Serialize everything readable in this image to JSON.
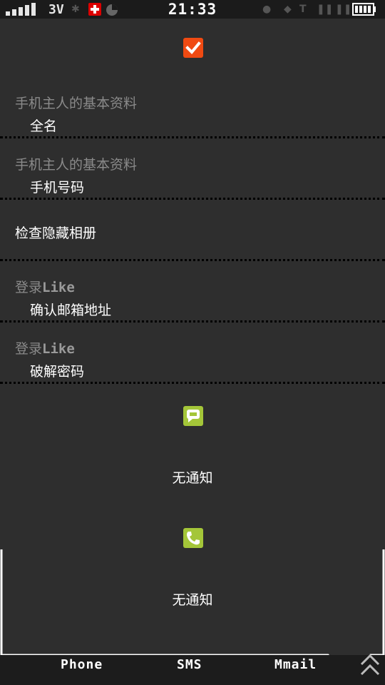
{
  "status_bar": {
    "network": "3V",
    "time": "21:33",
    "icons": [
      "signal-icon",
      "usb-icon",
      "medical-cross-icon",
      "pie-icon",
      "bluetooth-icon",
      "nfc-icon",
      "text-icon",
      "pause-icon",
      "battery-icon"
    ]
  },
  "header": {
    "icon": "checkbox-checked-icon",
    "accent": "#f04a12"
  },
  "rows": [
    {
      "title": "手机主人的基本资料",
      "subtitle": "全名"
    },
    {
      "title": "手机主人的基本资料",
      "subtitle": "手机号码"
    },
    {
      "label": "检查隐藏相册"
    },
    {
      "title_prefix": "登录",
      "title_brand": "Like",
      "subtitle": "确认邮箱地址"
    },
    {
      "title_prefix": "登录",
      "title_brand": "Like",
      "subtitle": "破解密码"
    }
  ],
  "notifications": [
    {
      "icon": "message-bubble-icon",
      "text": "无通知",
      "color": "#a4c639"
    },
    {
      "icon": "phone-icon",
      "text": "无通知",
      "color": "#a4c639"
    }
  ],
  "tabs": [
    {
      "label": "Phone"
    },
    {
      "label": "SMS"
    },
    {
      "label": "Mmail"
    }
  ],
  "scroll_up_icon": "double-chevron-up-icon"
}
